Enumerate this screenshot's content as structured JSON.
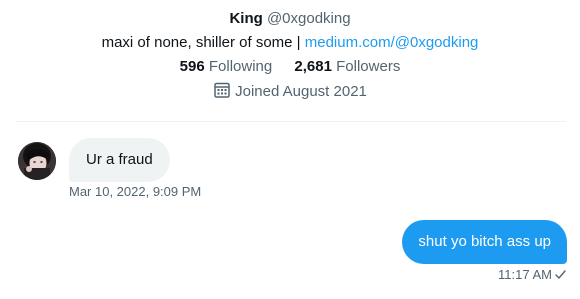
{
  "profile": {
    "display_name": "King",
    "handle": "@0xgodking",
    "bio_text": "maxi of none, shiller of some | ",
    "bio_link": "medium.com/@0xgodking",
    "following_count": "596",
    "following_label": "Following",
    "followers_count": "2,681",
    "followers_label": "Followers",
    "joined": "Joined August 2021"
  },
  "messages": [
    {
      "direction": "incoming",
      "text": "Ur a fraud",
      "timestamp": "Mar 10, 2022, 9:09 PM"
    },
    {
      "direction": "outgoing",
      "text": "shut yo bitch ass up",
      "timestamp": "11:17 AM"
    }
  ],
  "icons": {
    "calendar": "calendar-icon",
    "read_receipt": "check-icon"
  },
  "colors": {
    "accent": "#1d9bf0",
    "secondary_text": "#536471",
    "incoming_bubble": "#eff3f4",
    "primary_text": "#0f1419"
  }
}
